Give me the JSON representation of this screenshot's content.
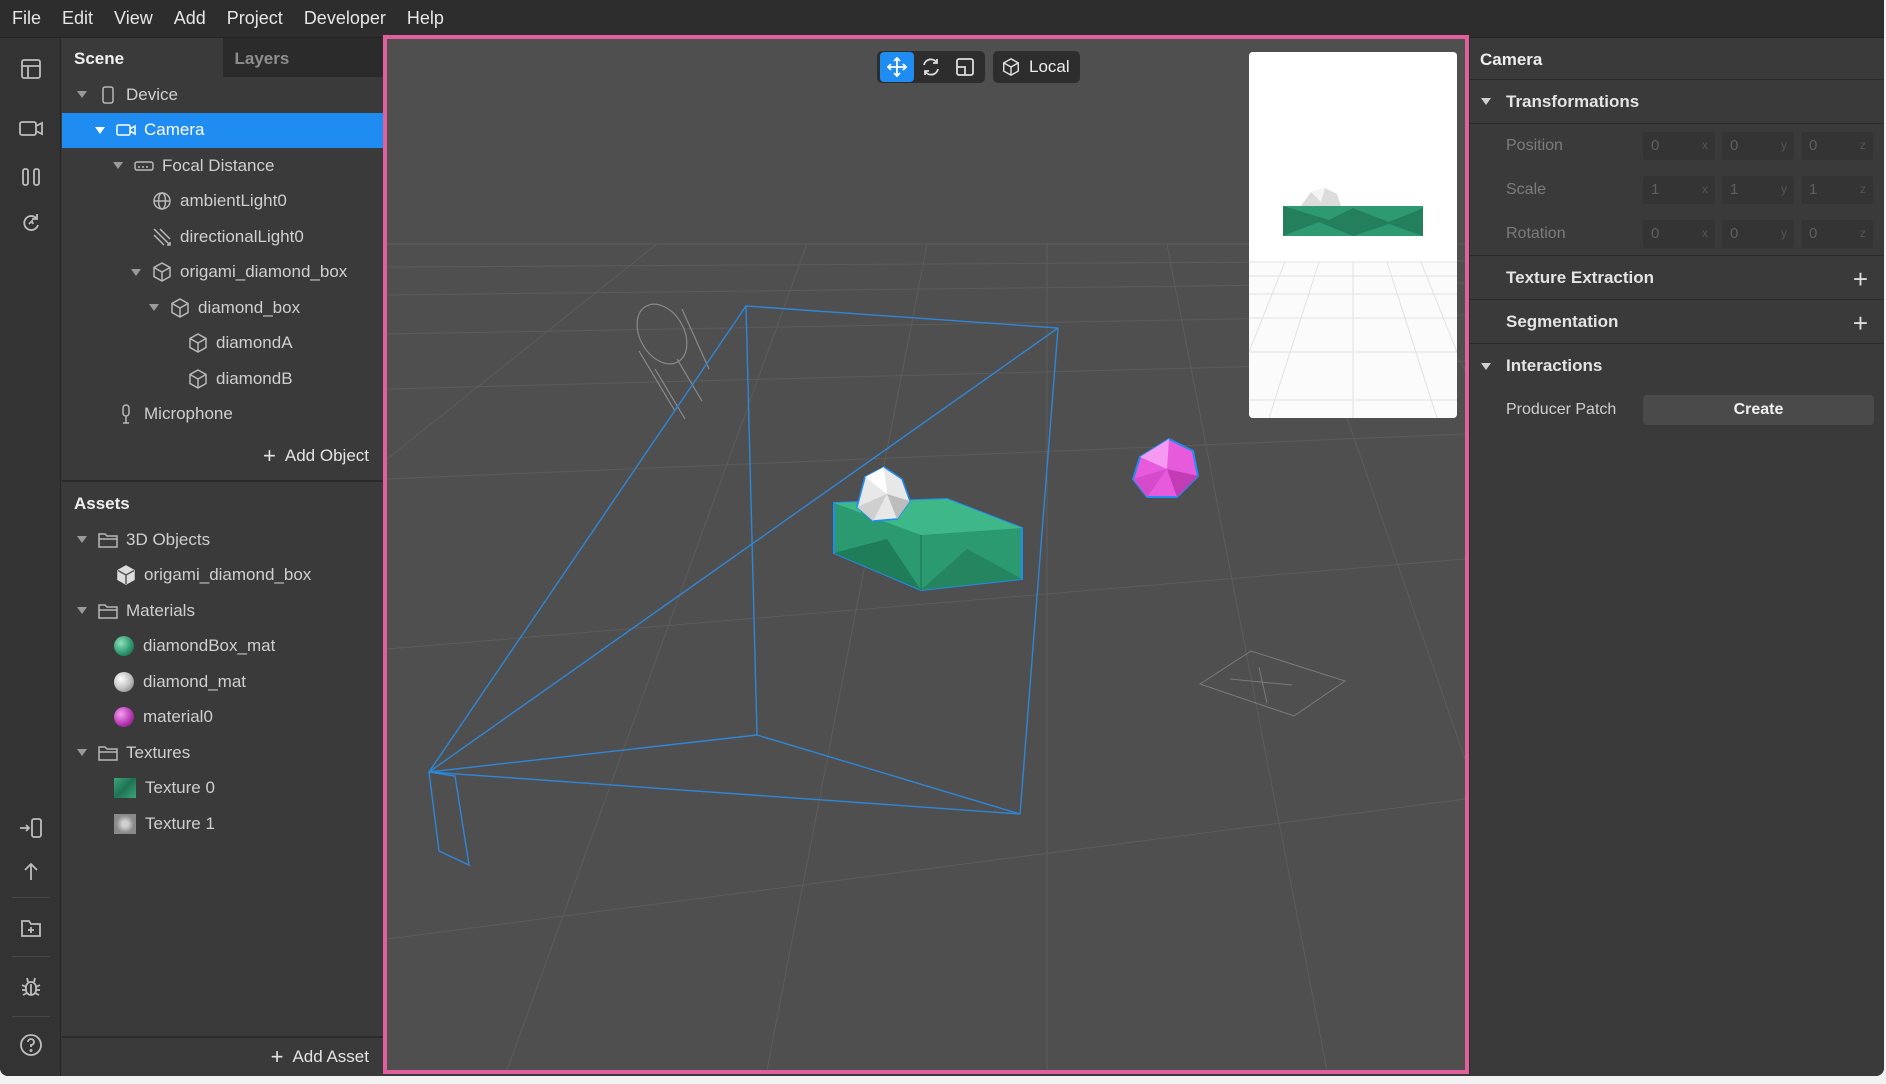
{
  "menu": [
    "File",
    "Edit",
    "View",
    "Add",
    "Project",
    "Developer",
    "Help"
  ],
  "scene_panel": {
    "tabs": [
      {
        "label": "Scene"
      },
      {
        "label": "Layers"
      }
    ],
    "tree": [
      {
        "label": "Device",
        "icon": "device-icon"
      },
      {
        "label": "Camera",
        "icon": "camera-icon",
        "selected": true
      },
      {
        "label": "Focal Distance",
        "icon": "focal-distance-icon"
      },
      {
        "label": "ambientLight0",
        "icon": "ambient-light-icon"
      },
      {
        "label": "directionalLight0",
        "icon": "directional-light-icon"
      },
      {
        "label": "origami_diamond_box",
        "icon": "3d-object-icon"
      },
      {
        "label": "diamond_box",
        "icon": "3d-object-icon"
      },
      {
        "label": "diamondA",
        "icon": "3d-object-icon"
      },
      {
        "label": "diamondB",
        "icon": "3d-object-icon"
      },
      {
        "label": "Microphone",
        "icon": "microphone-icon"
      }
    ],
    "add_object": "Add Object"
  },
  "assets": {
    "title": "Assets",
    "items": [
      {
        "label": "3D Objects",
        "icon": "folder-icon"
      },
      {
        "label": "origami_diamond_box",
        "icon": "3d-object-icon"
      },
      {
        "label": "Materials",
        "icon": "folder-icon"
      },
      {
        "label": "diamondBox_mat",
        "icon": "material-icon",
        "color": "#2f9a72"
      },
      {
        "label": "diamond_mat",
        "icon": "material-icon",
        "color": "#bdbdbd"
      },
      {
        "label": "material0",
        "icon": "material-icon",
        "color": "#b93ab5"
      },
      {
        "label": "Textures",
        "icon": "folder-icon"
      },
      {
        "label": "Texture 0",
        "icon": "texture-icon",
        "color": "#2f8f67"
      },
      {
        "label": "Texture 1",
        "icon": "texture-icon",
        "color": "#9a9a9a"
      }
    ],
    "add_asset": "Add Asset"
  },
  "viewport": {
    "space_label": "Local",
    "active_tool": "move",
    "accent": "#e0609e",
    "selection_color": "#1e8cf0"
  },
  "inspector": {
    "title": "Camera",
    "transformations": {
      "label": "Transformations",
      "position": {
        "label": "Position",
        "values": [
          "0",
          "0",
          "0"
        ],
        "axes": [
          "x",
          "y",
          "z"
        ]
      },
      "scale": {
        "label": "Scale",
        "values": [
          "1",
          "1",
          "1"
        ],
        "axes": [
          "x",
          "y",
          "z"
        ]
      },
      "rotation": {
        "label": "Rotation",
        "values": [
          "0",
          "0",
          "0"
        ],
        "axes": [
          "x",
          "y",
          "z"
        ]
      }
    },
    "texture_extraction": "Texture Extraction",
    "segmentation": "Segmentation",
    "interactions": {
      "label": "Interactions",
      "producer_patch": "Producer Patch",
      "create": "Create"
    }
  }
}
